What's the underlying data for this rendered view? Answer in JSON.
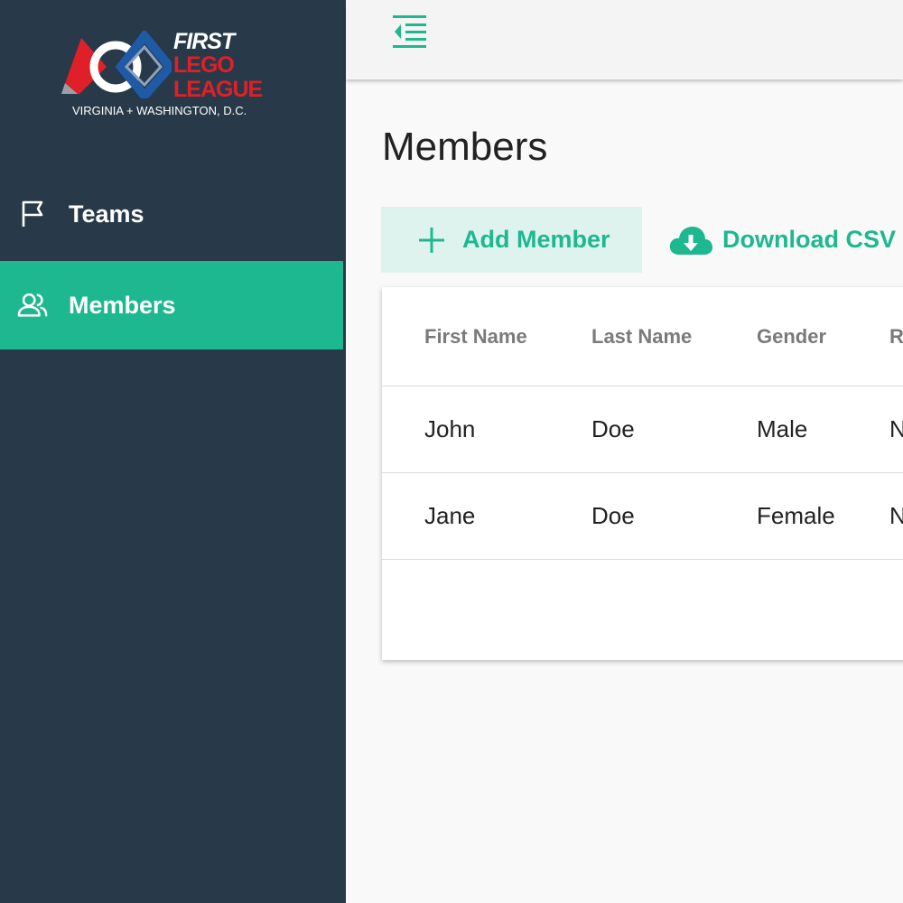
{
  "logo": {
    "first": "FIRST",
    "lego": "LEGO",
    "league": "LEAGUE",
    "region": "VIRGINIA + WASHINGTON, D.C."
  },
  "sidebar": {
    "items": [
      {
        "label": "Teams",
        "icon": "flag-icon",
        "active": false
      },
      {
        "label": "Members",
        "icon": "users-icon",
        "active": true
      }
    ]
  },
  "topbar": {
    "collapse_icon": "collapse-menu-icon"
  },
  "main": {
    "title": "Members",
    "add_label": "Add Member",
    "csv_label": "Download CSV"
  },
  "table": {
    "columns": [
      "First Name",
      "Last Name",
      "Gender",
      "R"
    ],
    "rows": [
      [
        "John",
        "Doe",
        "Male",
        "N"
      ],
      [
        "Jane",
        "Doe",
        "Female",
        "N"
      ]
    ]
  },
  "colors": {
    "sidebar": "#283a49",
    "accent": "#1db890",
    "accent_light": "#dff3ee",
    "logo_red": "#e02028"
  }
}
